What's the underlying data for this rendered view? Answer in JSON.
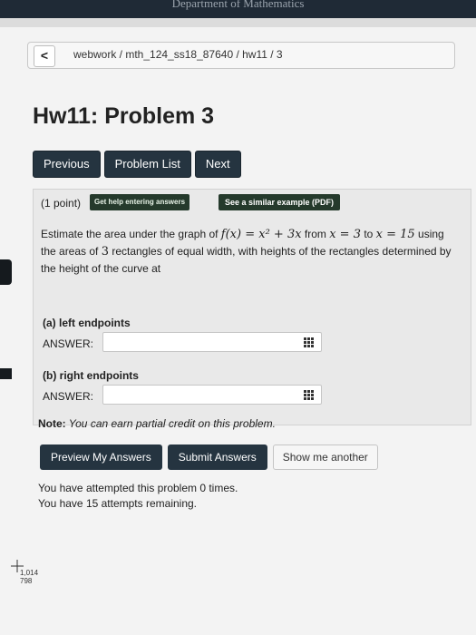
{
  "top": {
    "text": "Department of Mathematics"
  },
  "breadcrumb": {
    "back": "<",
    "path": "webwork / mth_124_ss18_87640 / hw11 / 3"
  },
  "title": "Hw11: Problem 3",
  "nav": {
    "previous": "Previous",
    "list": "Problem List",
    "next": "Next"
  },
  "problem": {
    "points": "(1 point)",
    "help": "Get help entering answers",
    "example": "See a similar example (PDF)",
    "q1": "Estimate the area under the graph of ",
    "fx": "f(x) = x² + 3x",
    "q2": " from ",
    "x0": "x = 3",
    "q3": " to",
    "x1": "x = 15",
    "q4": " using the areas of ",
    "n": "3",
    "q5": " rectangles of equal width, with heights of the rectangles determined by the height of the curve at",
    "a_label": "(a) left endpoints",
    "b_label": "(b) right endpoints",
    "answer": "ANSWER:"
  },
  "note": {
    "bold": "Note:",
    "text": " You can earn partial credit on this problem."
  },
  "actions": {
    "preview": "Preview My Answers",
    "submit": "Submit Answers",
    "another": "Show me another"
  },
  "attempts": {
    "line1": "You have attempted this problem 0 times.",
    "line2": "You have 15 attempts remaining."
  },
  "scan": {
    "a": "1,014",
    "b": "798"
  }
}
